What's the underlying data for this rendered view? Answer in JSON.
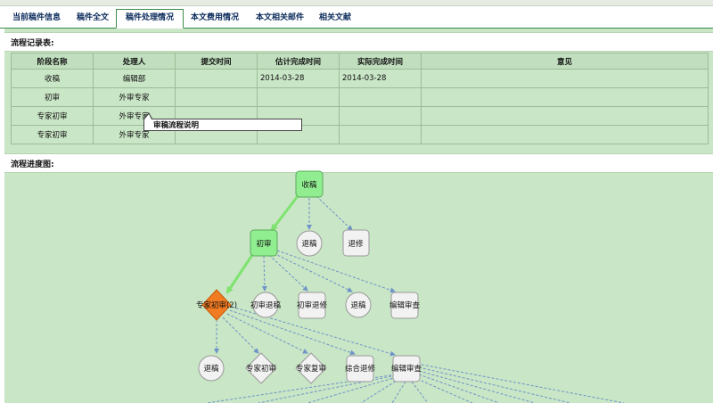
{
  "tabs": [
    {
      "label": "当前稿件信息",
      "active": false
    },
    {
      "label": "稿件全文",
      "active": false
    },
    {
      "label": "稿件处理情况",
      "active": true
    },
    {
      "label": "本文费用情况",
      "active": false
    },
    {
      "label": "本文相关邮件",
      "active": false
    },
    {
      "label": "相关文献",
      "active": false
    }
  ],
  "flow_record": {
    "title": "流程记录表:",
    "columns": [
      "阶段名称",
      "处理人",
      "提交时间",
      "估计完成时间",
      "实际完成时间",
      "意见"
    ],
    "rows": [
      [
        "收稿",
        "编辑部",
        "",
        "2014-03-28",
        "2014-03-28",
        ""
      ],
      [
        "初审",
        "外审专家",
        "",
        "",
        "",
        ""
      ],
      [
        "专家初审",
        "外审专家",
        "",
        "",
        "",
        ""
      ],
      [
        "专家初审",
        "外审专家",
        "",
        "",
        "",
        ""
      ]
    ]
  },
  "tooltip": {
    "text": "审稿流程说明"
  },
  "flow_chart": {
    "title": "流程进度图:",
    "nodes": {
      "shougao": "收稿",
      "chushen": "初审",
      "tuigao1": "退稿",
      "tuixiu1": "退修",
      "zhuanjia": "专家初审(2)",
      "chushentuigao": "初审退稿",
      "chushentuixiu": "初审退修",
      "tuigao2": "退稿",
      "bianjishencha1": "编辑审查",
      "tuigao3": "退稿",
      "zhuanjiachushen": "专家初审",
      "zhuanjiafushen": "专家复审",
      "zonghetuixiu": "综合退修",
      "bianjishencha2": "编辑审查"
    }
  },
  "colors": {
    "panel_bg": "#c9e6c6",
    "done_node": "#90ee90",
    "current_node": "#f07b22",
    "pending_node": "#f2f2f2",
    "done_edge": "#7ee36f",
    "pending_edge": "#6f93c8"
  }
}
